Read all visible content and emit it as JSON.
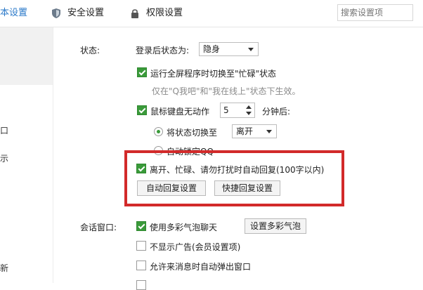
{
  "tabs": [
    {
      "label": "本设置",
      "active": true
    },
    {
      "label": "安全设置",
      "icon": "shield-icon"
    },
    {
      "label": "权限设置",
      "icon": "lock-icon"
    }
  ],
  "search": {
    "placeholder": "搜索设置项"
  },
  "sidebar": {
    "items": [
      "口",
      "示",
      "新"
    ]
  },
  "status": {
    "section_label": "状态:",
    "login_status_label": "登录后状态为:",
    "login_status_value": "隐身",
    "fullscreen_busy_label": "运行全屏程序时切换至\"忙碌\"状态",
    "fullscreen_busy_note": "仅在\"Q我吧\"和\"我在线上\"状态下生效。",
    "idle_label": "鼠标键盘无动作",
    "idle_minutes": "5",
    "idle_unit": "分钟后:",
    "switch_status_label": "将状态切换至",
    "switch_status_value": "离开",
    "auto_lock_label": "自动锁定QQ",
    "auto_reply_label": "离开、忙碌、请勿打扰时自动回复(100字以内)",
    "auto_reply_button": "自动回复设置",
    "quick_reply_button": "快捷回复设置"
  },
  "chat_window": {
    "section_label": "会话窗口:",
    "bubble_label": "使用多彩气泡聊天",
    "bubble_button": "设置多彩气泡",
    "no_ads_label": "不显示广告(会员设置项)",
    "auto_popup_label": "允许来消息时自动弹出窗口"
  },
  "colors": {
    "accent": "#2a79c9",
    "checkbox": "#3a9a3a",
    "highlight": "#d22a2a"
  }
}
